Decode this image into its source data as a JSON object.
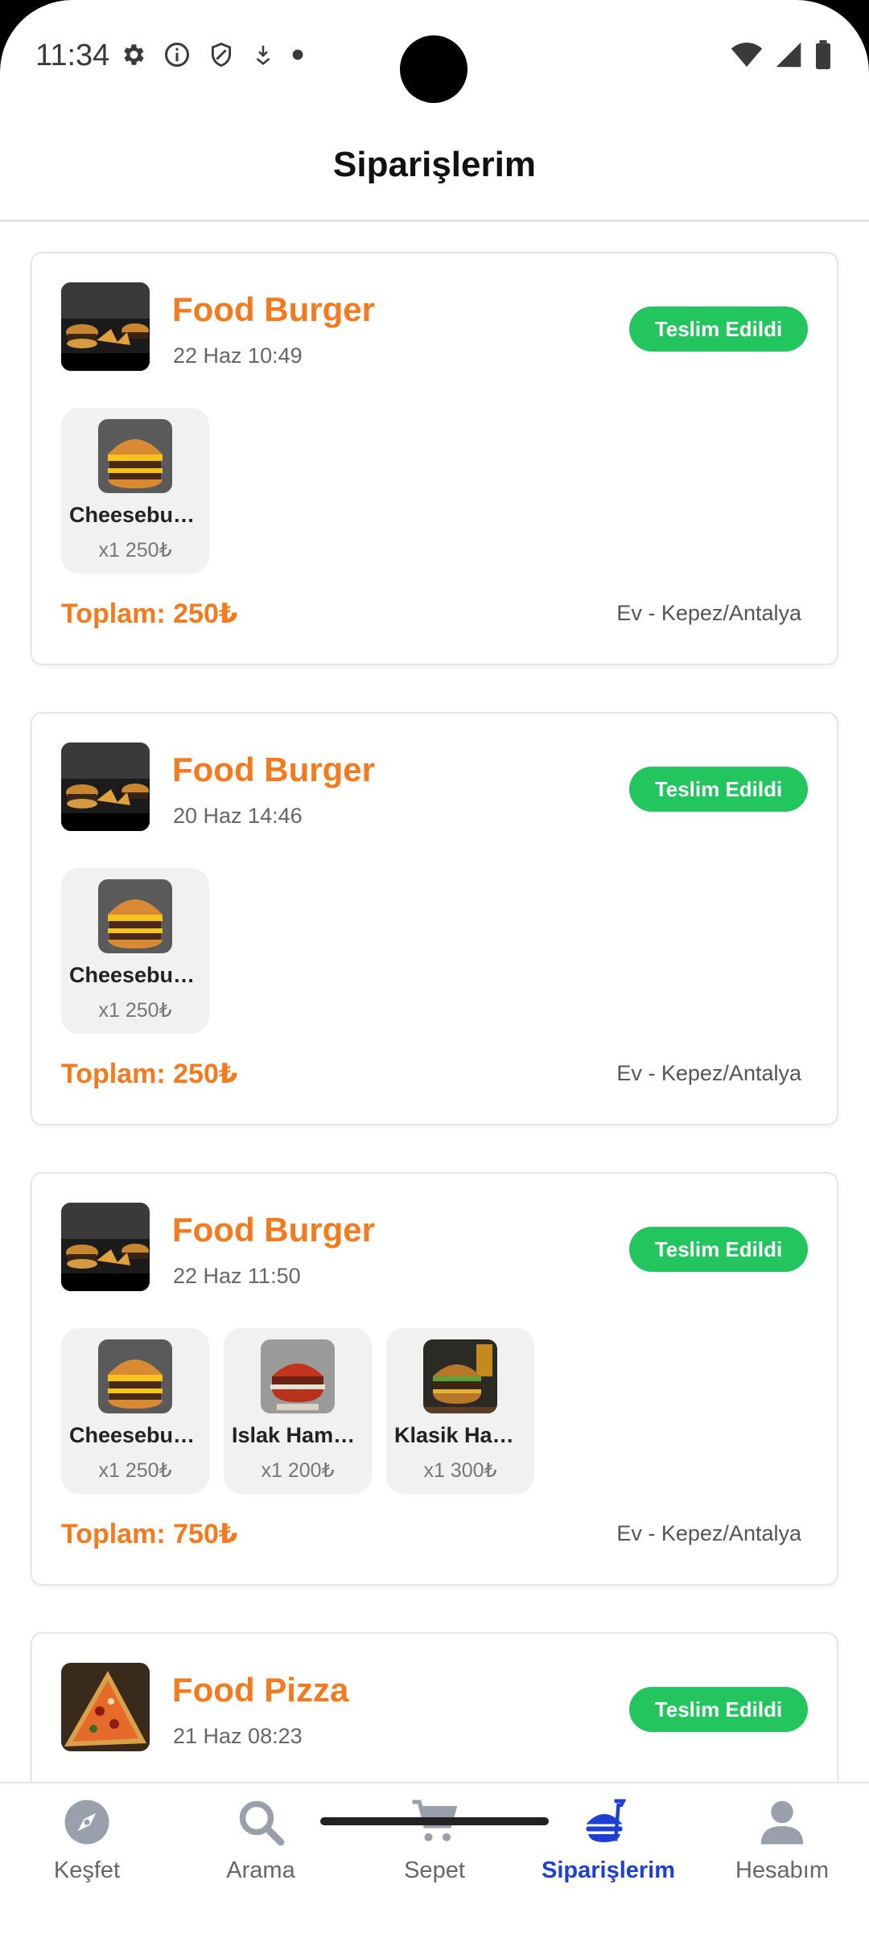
{
  "status_bar": {
    "time": "11:34"
  },
  "header": {
    "title": "Siparişlerim"
  },
  "orders": [
    {
      "restaurant": "Food Burger",
      "date": "22 Haz 10:49",
      "status": "Teslim Edildi",
      "items": [
        {
          "name": "Cheeseburger",
          "qty": "x1 250₺"
        }
      ],
      "total": "Toplam: 250₺",
      "address": "Ev - Kepez/Antalya"
    },
    {
      "restaurant": "Food Burger",
      "date": "20 Haz 14:46",
      "status": "Teslim Edildi",
      "items": [
        {
          "name": "Cheeseburger",
          "qty": "x1 250₺"
        }
      ],
      "total": "Toplam: 250₺",
      "address": "Ev - Kepez/Antalya"
    },
    {
      "restaurant": "Food Burger",
      "date": "22 Haz 11:50",
      "status": "Teslim Edildi",
      "items": [
        {
          "name": "Cheeseburger",
          "qty": "x1 250₺"
        },
        {
          "name": "Islak Hamburger",
          "qty": "x1 200₺"
        },
        {
          "name": "Klasik Hamburger",
          "qty": "x1 300₺"
        }
      ],
      "total": "Toplam: 750₺",
      "address": "Ev - Kepez/Antalya"
    },
    {
      "restaurant": "Food Pizza",
      "date": "21 Haz 08:23",
      "status": "Teslim Edildi"
    }
  ],
  "bottom_nav": {
    "items": [
      {
        "label": "Keşfet",
        "icon": "compass-icon"
      },
      {
        "label": "Arama",
        "icon": "search-icon"
      },
      {
        "label": "Sepet",
        "icon": "cart-icon"
      },
      {
        "label": "Siparişlerim",
        "icon": "orders-icon",
        "active": true
      },
      {
        "label": "Hesabım",
        "icon": "profile-icon"
      }
    ]
  },
  "colors": {
    "accent": "#f47a1f",
    "badge": "#22c55e",
    "nav_active": "#1d3fd6",
    "nav_inactive": "#9aa0ab"
  }
}
